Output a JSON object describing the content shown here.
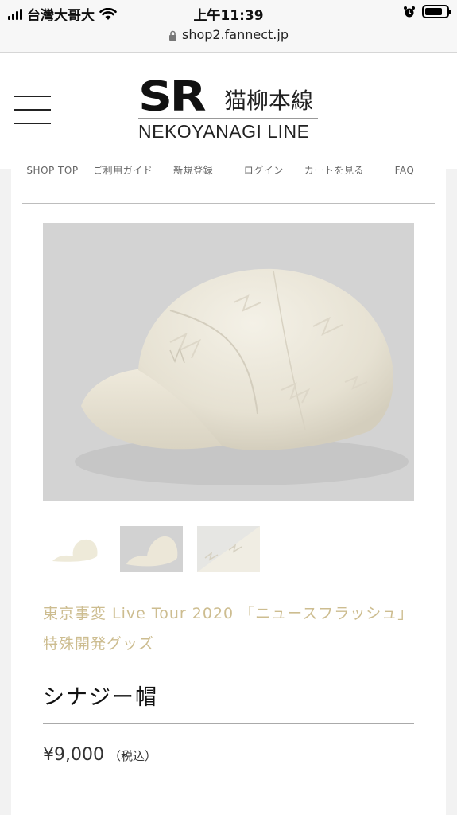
{
  "status_bar": {
    "carrier": "台灣大哥大",
    "time": "上午11:39"
  },
  "browser": {
    "url": "shop2.fannect.jp"
  },
  "header": {
    "logo_mark": "SR",
    "logo_jp": "猫柳本線",
    "logo_en": "NEKOYANAGI LINE"
  },
  "nav": {
    "items": [
      {
        "label": "SHOP TOP"
      },
      {
        "label": "ご利用ガイド"
      },
      {
        "label": "新規登録"
      },
      {
        "label": "ログイン"
      },
      {
        "label": "カートを見る"
      },
      {
        "label": "FAQ"
      }
    ]
  },
  "product": {
    "series": "東京事変 Live Tour 2020 「ニュースフラッシュ」特殊開発グッズ",
    "title": "シナジー帽",
    "price": "¥9,000",
    "tax_note": "（税込）"
  }
}
